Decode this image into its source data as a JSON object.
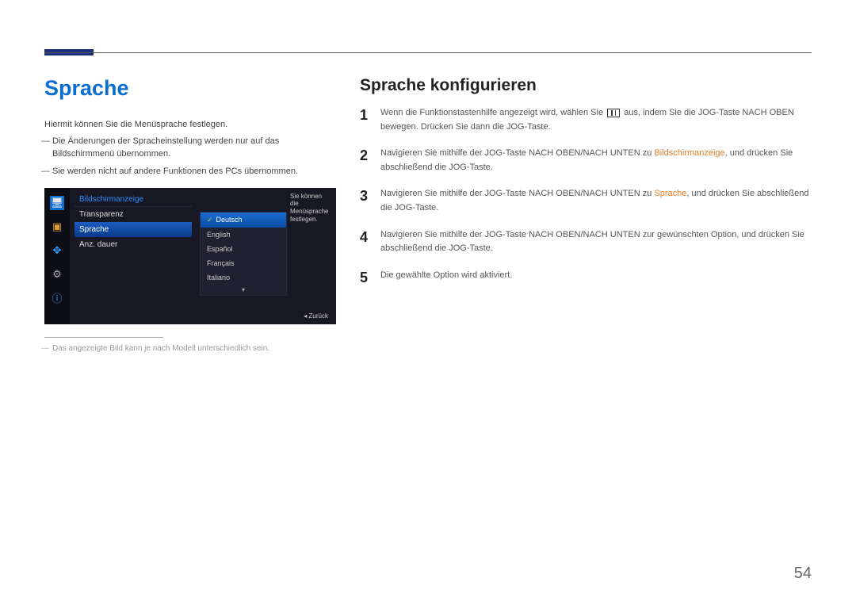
{
  "page_number": "54",
  "left": {
    "title": "Sprache",
    "intro": "Hiermit können Sie die Menüsprache festlegen.",
    "notes": [
      "Die Änderungen der Spracheinstellung werden nur auf das Bildschirmmenü übernommen.",
      "Sie werden nicht auf andere Funktionen des PCs übernommen."
    ],
    "footnote": "Das angezeigte Bild kann je nach Modell unterschiedlich sein."
  },
  "osd": {
    "menu_title": "Bildschirmanzeige",
    "items": [
      "Transparenz",
      "Sprache",
      "Anz. dauer"
    ],
    "selected_item": "Sprache",
    "options": [
      "Deutsch",
      "English",
      "Español",
      "Français",
      "Italiano"
    ],
    "selected_option": "Deutsch",
    "hint": "Sie können die Menüsprache festlegen.",
    "back_label": "Zurück"
  },
  "right": {
    "title": "Sprache konfigurieren",
    "steps": [
      {
        "num": "1",
        "pre": "Wenn die Funktionstastenhilfe angezeigt wird, wählen Sie ",
        "post": " aus, indem Sie die JOG-Taste NACH OBEN bewegen. Drücken Sie dann die JOG-Taste."
      },
      {
        "num": "2",
        "pre": "Navigieren Sie mithilfe der JOG-Taste NACH OBEN/NACH UNTEN zu ",
        "orange": "Bildschirmanzeige",
        "post": ", und drücken Sie abschließend die JOG-Taste."
      },
      {
        "num": "3",
        "pre": "Navigieren Sie mithilfe der JOG-Taste NACH OBEN/NACH UNTEN zu ",
        "orange": "Sprache",
        "post": ", und drücken Sie abschließend die JOG-Taste."
      },
      {
        "num": "4",
        "text": "Navigieren Sie mithilfe der JOG-Taste NACH OBEN/NACH UNTEN zur gewünschten Option, und drücken Sie abschließend die JOG-Taste."
      },
      {
        "num": "5",
        "text": "Die gewählte Option wird aktiviert."
      }
    ]
  }
}
